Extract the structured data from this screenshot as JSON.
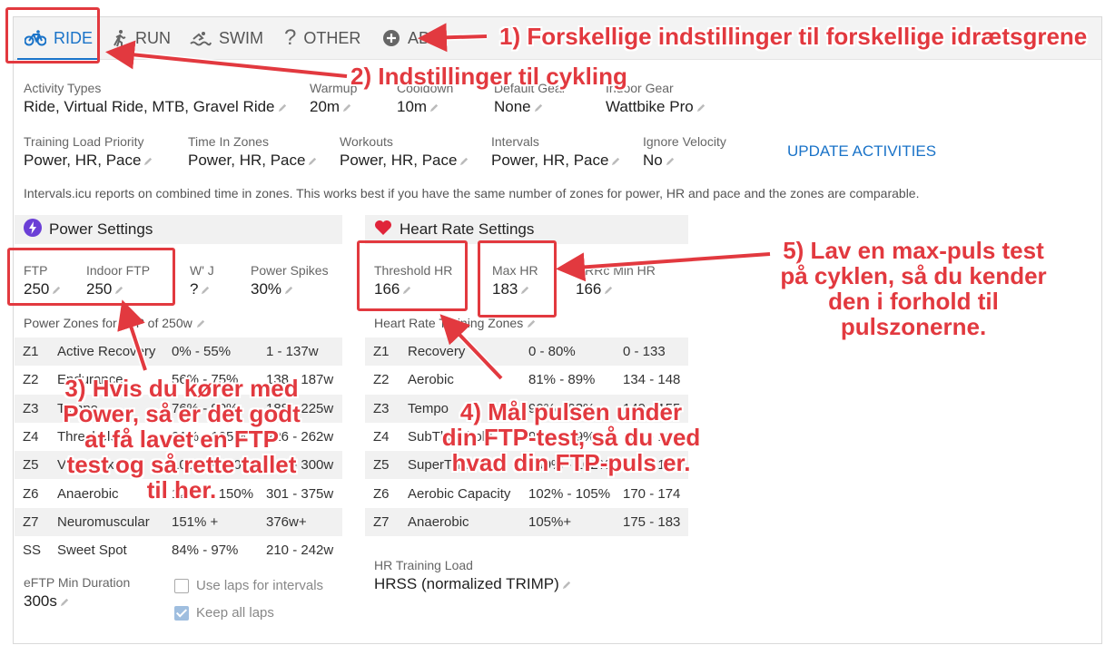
{
  "tabs": [
    {
      "label": "RIDE",
      "icon": "bike-icon"
    },
    {
      "label": "RUN",
      "icon": "runner-icon"
    },
    {
      "label": "SWIM",
      "icon": "swimmer-icon"
    },
    {
      "label": "OTHER",
      "icon": "question-icon"
    },
    {
      "label": "ADD",
      "icon": "plus-circle-icon"
    }
  ],
  "settings": {
    "activity_types": {
      "label": "Activity Types",
      "value": "Ride, Virtual Ride, MTB, Gravel Ride"
    },
    "warmup": {
      "label": "Warmup",
      "value": "20m"
    },
    "cooldown": {
      "label": "Cooldown",
      "value": "10m"
    },
    "default_gear": {
      "label": "Default Gear",
      "value": "None"
    },
    "indoor_gear": {
      "label": "Indoor Gear",
      "value": "Wattbike Pro"
    },
    "training_load_priority": {
      "label": "Training Load Priority",
      "value": "Power, HR, Pace"
    },
    "time_in_zones": {
      "label": "Time In Zones",
      "value": "Power, HR, Pace"
    },
    "workouts": {
      "label": "Workouts",
      "value": "Power, HR, Pace"
    },
    "intervals": {
      "label": "Intervals",
      "value": "Power, HR, Pace"
    },
    "ignore_velocity": {
      "label": "Ignore Velocity",
      "value": "No"
    },
    "update_label": "UPDATE ACTIVITIES",
    "note": "Intervals.icu reports on combined time in zones. This works best if you have the same number of zones for power, HR and pace and the zones are comparable."
  },
  "power": {
    "title": "Power Settings",
    "ftp": {
      "label": "FTP",
      "value": "250"
    },
    "indoor_ftp": {
      "label": "Indoor FTP",
      "value": "250"
    },
    "wj": {
      "label": "W' J",
      "value": "?"
    },
    "spikes": {
      "label": "Power Spikes",
      "value": "30%"
    },
    "zones_title": "Power Zones for FTP of 250w",
    "zones": [
      {
        "id": "Z1",
        "name": "Active Recovery",
        "pct": "0% - 55%",
        "range": "1 - 137w"
      },
      {
        "id": "Z2",
        "name": "Endurance",
        "pct": "56% - 75%",
        "range": "138 - 187w"
      },
      {
        "id": "Z3",
        "name": "Tempo",
        "pct": "76% - 90%",
        "range": "188 - 225w"
      },
      {
        "id": "Z4",
        "name": "Threshold",
        "pct": "91% - 105%",
        "range": "226 - 262w"
      },
      {
        "id": "Z5",
        "name": "VO2 Max",
        "pct": "106% - 120%",
        "range": "263 - 300w"
      },
      {
        "id": "Z6",
        "name": "Anaerobic",
        "pct": "121% - 150%",
        "range": "301 - 375w"
      },
      {
        "id": "Z7",
        "name": "Neuromuscular",
        "pct": "151% +",
        "range": "376w+"
      },
      {
        "id": "SS",
        "name": "Sweet Spot",
        "pct": "84% - 97%",
        "range": "210 - 242w"
      }
    ],
    "eftp": {
      "label": "eFTP Min Duration",
      "value": "300s"
    },
    "use_laps": {
      "label": "Use laps for intervals",
      "checked": false
    },
    "keep_laps": {
      "label": "Keep all laps",
      "checked": true
    }
  },
  "hr": {
    "title": "Heart Rate Settings",
    "threshold": {
      "label": "Threshold HR",
      "value": "166"
    },
    "max": {
      "label": "Max HR",
      "value": "183"
    },
    "hrrc": {
      "label": "HRRc Min HR",
      "value": "166"
    },
    "zones_title": "Heart Rate Training Zones",
    "zones": [
      {
        "id": "Z1",
        "name": "Recovery",
        "pct": "0 - 80%",
        "range": "0 - 133"
      },
      {
        "id": "Z2",
        "name": "Aerobic",
        "pct": "81% - 89%",
        "range": "134 - 148"
      },
      {
        "id": "Z3",
        "name": "Tempo",
        "pct": "90% - 93%",
        "range": "149 - 155"
      },
      {
        "id": "Z4",
        "name": "SubThreshold",
        "pct": "94% - 99%",
        "range": "156 - 165"
      },
      {
        "id": "Z5",
        "name": "SuperThreshold",
        "pct": "100% - 102%",
        "range": "166 - 169"
      },
      {
        "id": "Z6",
        "name": "Aerobic Capacity",
        "pct": "102% - 105%",
        "range": "170 - 174"
      },
      {
        "id": "Z7",
        "name": "Anaerobic",
        "pct": "105%+",
        "range": "175 - 183"
      }
    ],
    "training_load": {
      "label": "HR Training Load",
      "value": "HRSS (normalized TRIMP)"
    }
  },
  "callouts": {
    "c1": "1) Forskellige indstillinger til forskellige idrætsgrene",
    "c2": "2) Indstillinger til cykling",
    "c3": [
      "3) Hvis du kører med",
      "Power, så er det godt",
      "at få lavet en FTP",
      "test og så rette tallet",
      "til her."
    ],
    "c4": [
      "4) Mål pulsen under",
      "din FTP-test, så du ved",
      "hvad din FTP-puls er."
    ],
    "c5": [
      "5) Lav en max-puls test",
      "på cyklen, så du kender",
      "den i forhold til",
      "pulszonerne."
    ]
  },
  "colors": {
    "accent": "#1a73c8",
    "annotation": "#e2393f",
    "heart": "#e0243a",
    "bolt": "#6b3fd6"
  }
}
